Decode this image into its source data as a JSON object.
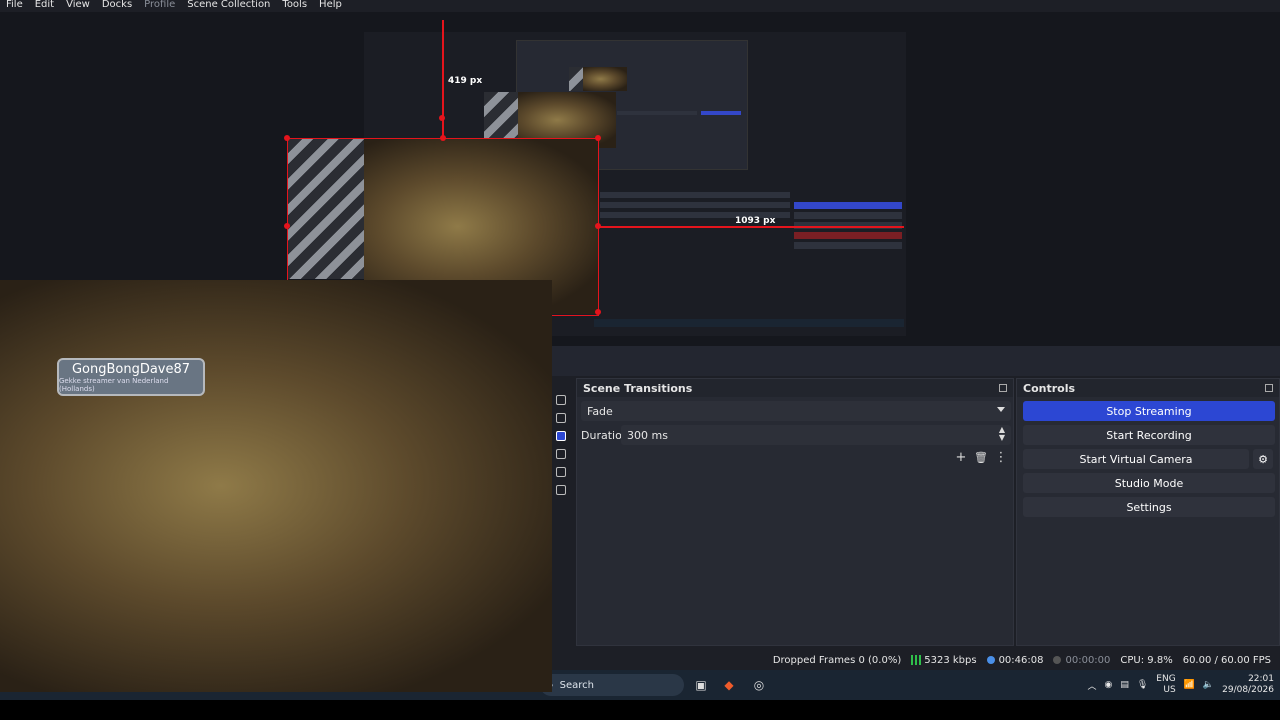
{
  "menu": [
    "File",
    "Edit",
    "View",
    "Docks",
    "Profile",
    "Scene Collection",
    "Tools",
    "Help"
  ],
  "menu_disabled_index": 4,
  "preview": {
    "measure_vertical": "419 px",
    "measure_horizontal": "1093 px"
  },
  "webcam": {
    "nameplate": "GongBongDave87",
    "nameplate_sub": "Gekke streamer van Nederland (Hollands)"
  },
  "scene_transitions": {
    "title": "Scene Transitions",
    "selected": "Fade",
    "duration_label": "Duration",
    "duration_value": "300 ms"
  },
  "controls": {
    "title": "Controls",
    "stop_streaming": "Stop Streaming",
    "start_recording": "Start Recording",
    "start_virtual_camera": "Start Virtual Camera",
    "studio_mode": "Studio Mode",
    "settings": "Settings"
  },
  "status": {
    "dropped_frames": "Dropped Frames 0 (0.0%)",
    "bitrate": "5323 kbps",
    "stream_time": "00:46:08",
    "rec_time": "00:00:00",
    "cpu": "CPU: 9.8%",
    "fps": "60.00 / 60.00 FPS"
  },
  "taskbar": {
    "search_placeholder": "Search",
    "lang": "ENG",
    "region": "US",
    "time": "22:01",
    "date": "29/08/2026"
  },
  "colors": {
    "accent": "#2c47d3",
    "selection": "#e5141c",
    "stream_ok": "#2fbf4a"
  }
}
